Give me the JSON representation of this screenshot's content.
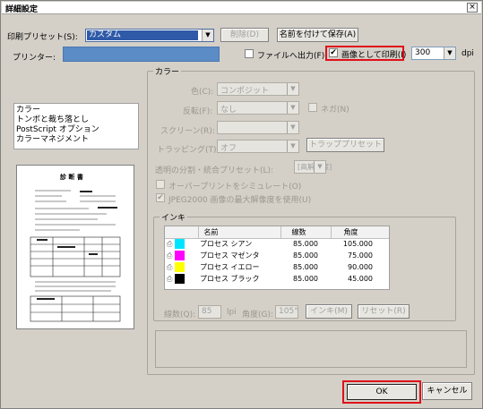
{
  "window": {
    "title": "詳細設定",
    "close": "×"
  },
  "toolbar": {
    "preset_label": "印刷プリセット(S):",
    "preset_value": "カスタム",
    "delete_label": "削除(D)",
    "save_as_label": "名前を付けて保存(A)"
  },
  "printer": {
    "label": "プリンター:",
    "output_file_label": "ファイルへ出力(F)",
    "print_as_image_label": "画像として印刷(I)",
    "print_as_image_checked": "✔",
    "dpi_value": "300",
    "dpi_unit": "dpi"
  },
  "sidebar": {
    "items": [
      {
        "label": "カラー"
      },
      {
        "label": "トンボと裁ち落とし"
      },
      {
        "label": "PostScript オプション"
      },
      {
        "label": "カラーマネジメント"
      }
    ]
  },
  "preview": {
    "doc_title": "診 断 書"
  },
  "color": {
    "group_title": "カラー",
    "color_label": "色(C):",
    "color_value": "コンポジット",
    "flip_label": "反転(F):",
    "flip_value": "なし",
    "negative_label": "ネガ(N)",
    "screen_label": "スクリーン(R):",
    "screen_value": "",
    "trapping_label": "トラッピング(T):",
    "trapping_value": "オフ",
    "trap_preset_label": "トラッププリセット",
    "flatten_label": "透明の分割・統合プリセット(L):",
    "flatten_value": "[高解像度]",
    "overprint_label": "オーバープリントをシミュレート(O)",
    "jpeg_label": "JPEG2000 画像の最大解像度を使用(U)",
    "jpeg_checked": "✔"
  },
  "ink": {
    "group_title": "インキ",
    "headers": [
      "名前",
      "線数",
      "角度"
    ],
    "rows": [
      {
        "name": "プロセス シアン",
        "freq": "85.000",
        "angle": "105.000",
        "color": "#00e5ff"
      },
      {
        "name": "プロセス マゼンタ",
        "freq": "85.000",
        "angle": "75.000",
        "color": "#ff00ff"
      },
      {
        "name": "プロセス イエロー",
        "freq": "85.000",
        "angle": "90.000",
        "color": "#ffff00"
      },
      {
        "name": "プロセス ブラック",
        "freq": "85.000",
        "angle": "45.000",
        "color": "#000000"
      }
    ],
    "freq_label": "線数(Q):",
    "freq_value": "85",
    "lpi_label": "lpi",
    "angle_label": "角度(G):",
    "angle_value": "105°",
    "ink_button": "インキ(M)",
    "reset_button": "リセット(R)"
  },
  "footer": {
    "ok_label": "OK",
    "cancel_label": "キャンセル"
  }
}
